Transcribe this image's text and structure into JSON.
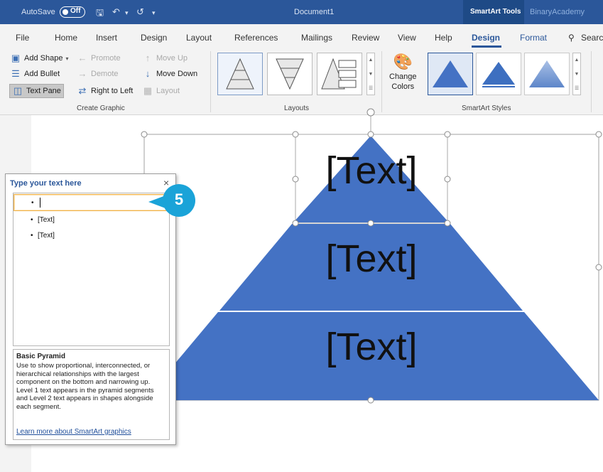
{
  "titlebar": {
    "autosave_label": "AutoSave",
    "autosave_state": "Off",
    "document_title": "Document1",
    "context_tab_group": "SmartArt Tools",
    "account": "BinaryAcademy"
  },
  "tabs": [
    "File",
    "Home",
    "Insert",
    "Design",
    "Layout",
    "References",
    "Mailings",
    "Review",
    "View",
    "Help",
    "Design",
    "Format",
    "Search"
  ],
  "active_tab": "Design",
  "ribbon": {
    "create_graphic": {
      "add_shape": "Add Shape",
      "promote": "Promote",
      "move_up": "Move Up",
      "add_bullet": "Add Bullet",
      "demote": "Demote",
      "move_down": "Move Down",
      "text_pane": "Text Pane",
      "right_to_left": "Right to Left",
      "layout": "Layout",
      "group_label": "Create Graphic"
    },
    "layouts": {
      "group_label": "Layouts"
    },
    "smartart_styles": {
      "change_colors_1": "Change",
      "change_colors_2": "Colors",
      "group_label": "SmartArt Styles"
    }
  },
  "smartart": {
    "segments": [
      "[Text]",
      "[Text]",
      "[Text]"
    ],
    "fill_color": "#4472c4"
  },
  "text_pane": {
    "title": "Type your text here",
    "close": "×",
    "items": [
      {
        "bullet": "•",
        "text": ""
      },
      {
        "bullet": "•",
        "text": "[Text]"
      },
      {
        "bullet": "•",
        "text": "[Text]"
      }
    ],
    "description_title": "Basic Pyramid",
    "description_body": "Use to show proportional, interconnected, or hierarchical relationships with the largest component on the bottom and narrowing up. Level 1 text appears in the pyramid segments and Level 2 text appears in shapes alongside each segment.",
    "learn_more": "Learn more about SmartArt graphics"
  },
  "step_marker": "5",
  "colors": {
    "title_bar": "#2b579a",
    "pyramid": "#4472c4",
    "marker": "#1aa3d8",
    "active_row_border": "#f0b24b"
  }
}
